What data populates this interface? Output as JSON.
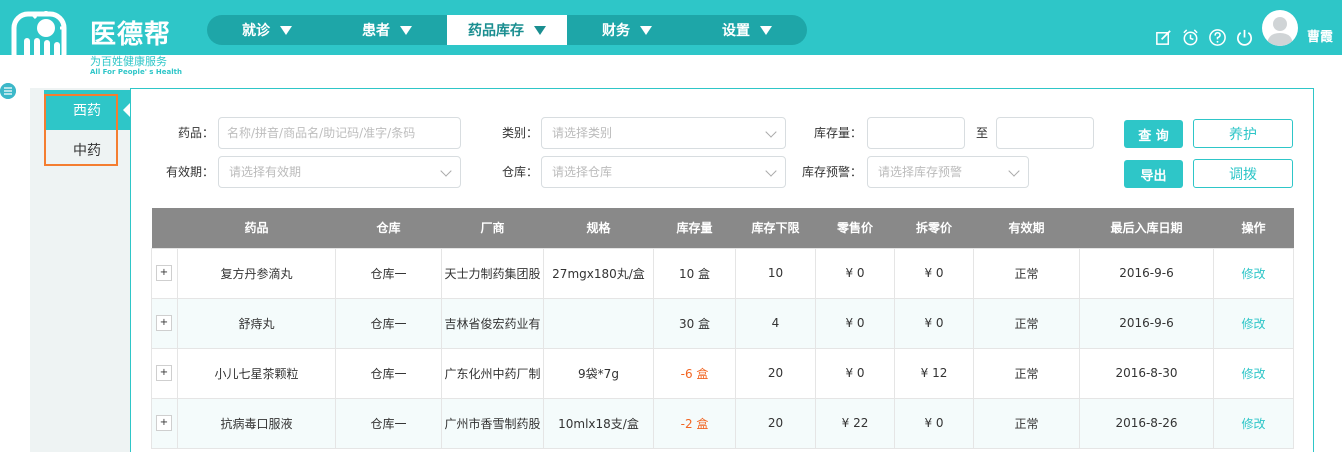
{
  "brand": {
    "name": "医德帮",
    "tagline_cn": "为百姓健康服务",
    "tagline_en": "All For People' s Health",
    "color": "#2ec6c8"
  },
  "nav": [
    {
      "label": "就诊"
    },
    {
      "label": "患者"
    },
    {
      "label": "药品库存"
    },
    {
      "label": "财务"
    },
    {
      "label": "设置"
    }
  ],
  "user": {
    "name": "曹霞"
  },
  "header_icons": [
    "edit-icon",
    "alarm-icon",
    "help-icon",
    "power-icon"
  ],
  "sidebar": {
    "items": [
      {
        "label": "西药"
      },
      {
        "label": "中药"
      }
    ]
  },
  "filters": {
    "drug_label": "药品：",
    "drug_placeholder": "名称/拼音/商品名/助记码/准字/条码",
    "category_label": "类别：",
    "category_placeholder": "请选择类别",
    "stock_label": "库存量：",
    "to_label": "至",
    "expiry_label": "有效期：",
    "expiry_placeholder": "请选择有效期",
    "warehouse_label": "仓库：",
    "warehouse_placeholder": "请选择仓库",
    "warning_label": "库存预警：",
    "warning_placeholder": "请选择库存预警"
  },
  "buttons": {
    "query": "查 询",
    "maintain": "养护",
    "export": "导出",
    "transfer": "调拨"
  },
  "table": {
    "columns": [
      "",
      "药品",
      "仓库",
      "厂商",
      "规格",
      "库存量",
      "库存下限",
      "零售价",
      "拆零价",
      "有效期",
      "最后入库日期",
      "操作"
    ],
    "rows": [
      {
        "drug": "复方丹参滴丸",
        "warehouse": "仓库一",
        "maker": "天士力制药集团股",
        "spec": "27mgx180丸/盒",
        "stock": "10 盒",
        "min": "10",
        "retail": "¥ 0",
        "split": "¥ 0",
        "expiry": "正常",
        "date": "2016-9-6",
        "action": "修改",
        "negative": false
      },
      {
        "drug": "舒痔丸",
        "warehouse": "仓库一",
        "maker": "吉林省俊宏药业有",
        "spec": "",
        "stock": "30 盒",
        "min": "4",
        "retail": "¥ 0",
        "split": "¥ 0",
        "expiry": "正常",
        "date": "2016-9-6",
        "action": "修改",
        "negative": false
      },
      {
        "drug": "小儿七星茶颗粒",
        "warehouse": "仓库一",
        "maker": "广东化州中药厂制",
        "spec": "9袋*7g",
        "stock": "-6 盒",
        "min": "20",
        "retail": "¥ 0",
        "split": "¥ 12",
        "expiry": "正常",
        "date": "2016-8-30",
        "action": "修改",
        "negative": true
      },
      {
        "drug": "抗病毒口服液",
        "warehouse": "仓库一",
        "maker": "广州市香雪制药股",
        "spec": "10mlx18支/盒",
        "stock": "-2 盒",
        "min": "20",
        "retail": "¥ 22",
        "split": "¥ 0",
        "expiry": "正常",
        "date": "2016-8-26",
        "action": "修改",
        "negative": true
      }
    ]
  },
  "colors": {
    "accent": "#2ec6c8",
    "negative": "#f26522",
    "highlight_box": "#f47d30"
  }
}
